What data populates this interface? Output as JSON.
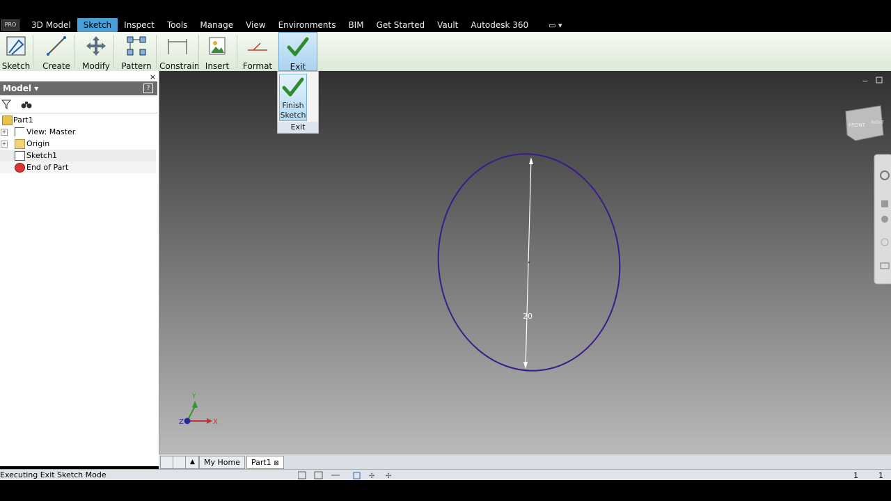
{
  "menu": {
    "pro_label": "PRO",
    "tabs": [
      "3D Model",
      "Sketch",
      "Inspect",
      "Tools",
      "Manage",
      "View",
      "Environments",
      "BIM",
      "Get Started",
      "Vault",
      "Autodesk 360"
    ],
    "active_tab": "Sketch"
  },
  "ribbon": {
    "buttons": [
      "Sketch",
      "Create",
      "Modify",
      "Pattern",
      "Constrain",
      "Insert",
      "Format",
      "Exit"
    ]
  },
  "dropdown": {
    "finish_label_1": "Finish",
    "finish_label_2": "Sketch",
    "footer": "Exit"
  },
  "panel": {
    "close": "×",
    "title": "Model ▾",
    "help": "?",
    "tree": [
      "Part1",
      "View: Master",
      "Origin",
      "Sketch1",
      "End of Part"
    ]
  },
  "viewport": {
    "dimension": "20",
    "axes": {
      "x": "X",
      "y": "Y",
      "z": "Z"
    },
    "viewcube_front": "FRONT",
    "viewcube_right": "RIGHT",
    "colors": {
      "sketch": "#3b1a8c",
      "dimension": "#ffffff"
    }
  },
  "doc_tabs": {
    "home": "My Home",
    "part": "Part1"
  },
  "status": {
    "text": "Executing Exit Sketch Mode",
    "page_a": "1",
    "page_b": "1"
  }
}
